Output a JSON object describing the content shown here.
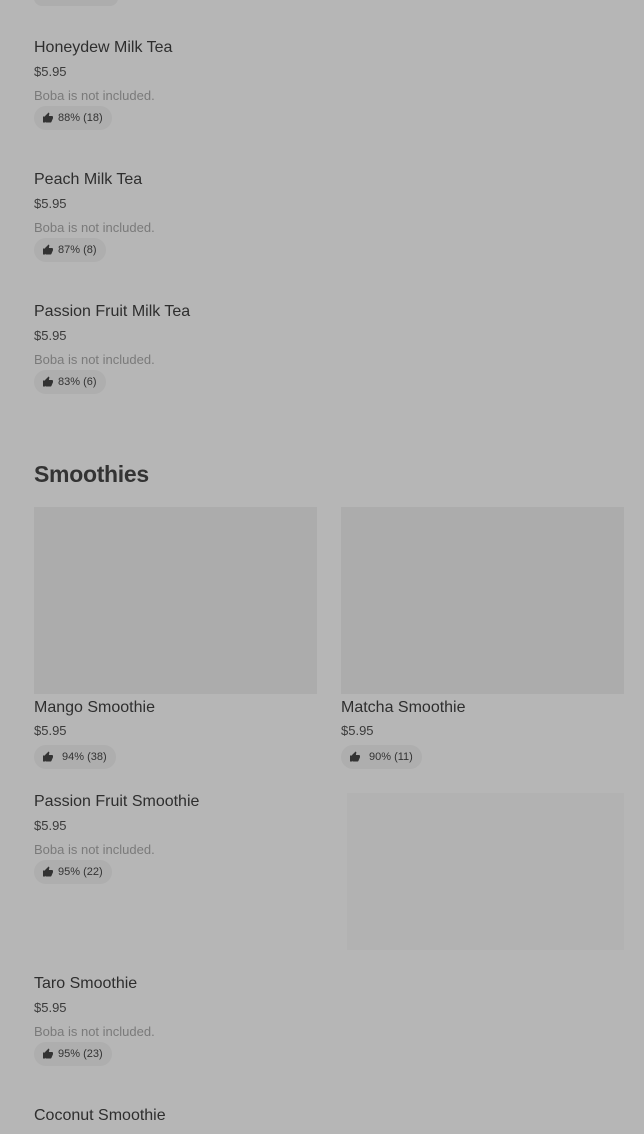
{
  "colors": {
    "background": "#b6b6b6",
    "text_primary": "#2e2e2e",
    "text_secondary": "#7a7a7a",
    "pill_background": "#aeaeae",
    "image_placeholder": "#acacac"
  },
  "top_items": [
    {
      "name": "Honeydew Milk Tea",
      "price": "$5.95",
      "description": "Boba is not included.",
      "rating": "88% (18)",
      "rating_icon": "thumbs-up-icon"
    },
    {
      "name": "Peach Milk Tea",
      "price": "$5.95",
      "description": "Boba is not included.",
      "rating": "87% (8)",
      "rating_icon": "thumbs-up-icon"
    },
    {
      "name": "Passion Fruit Milk Tea",
      "price": "$5.95",
      "description": "Boba is not included.",
      "rating": "83% (6)",
      "rating_icon": "thumbs-up-icon"
    }
  ],
  "smoothies": {
    "title": "Smoothies",
    "cards": [
      {
        "name": "Mango Smoothie",
        "price": "$5.95",
        "rating": "94% (38)",
        "rating_icon": "thumbs-up-icon"
      },
      {
        "name": "Matcha Smoothie",
        "price": "$5.95",
        "rating": "90% (11)",
        "rating_icon": "thumbs-up-icon"
      }
    ],
    "items": [
      {
        "name": "Passion Fruit Smoothie",
        "price": "$5.95",
        "description": "Boba is not included.",
        "rating": "95% (22)",
        "rating_icon": "thumbs-up-icon"
      },
      {
        "name": "Taro Smoothie",
        "price": "$5.95",
        "description": "Boba is not included.",
        "rating": "95% (23)",
        "rating_icon": "thumbs-up-icon"
      },
      {
        "name": "Coconut Smoothie"
      }
    ]
  }
}
